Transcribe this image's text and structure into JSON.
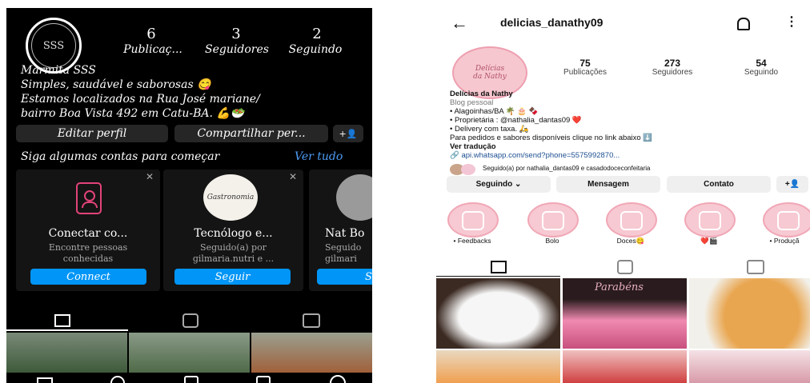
{
  "left": {
    "avatar_text": "SSS",
    "stats": [
      {
        "value": "6",
        "label": "Publicaç..."
      },
      {
        "value": "3",
        "label": "Seguidores"
      },
      {
        "value": "2",
        "label": "Seguindo"
      }
    ],
    "bio": [
      "Marmita SSS",
      "Simples, saudável e saborosas 😋",
      "Estamos localizados na Rua José mariane/",
      "bairro Boa Vista 492 em Catu-BA. 💪🥗"
    ],
    "buttons": {
      "edit": "Editar perfil",
      "share": "Compartilhar per...",
      "add": "+👤"
    },
    "suggest_heading": "Siga algumas contas para começar",
    "see_all": "Ver tudo",
    "cards": [
      {
        "title": "Conectar co...",
        "subtitle": "Encontre pessoas conhecidas",
        "button": "Connect"
      },
      {
        "title": "Tecnólogo e...",
        "subtitle": "Seguido(a) por gilmaria.nutri e ...",
        "button": "Seguir",
        "logo": "Gastronomia"
      },
      {
        "title": "Nat Bo",
        "subtitle": "Seguido gilmari",
        "button": "Seg"
      }
    ],
    "accent": "#0095f6"
  },
  "right": {
    "username": "delicias_danathy09",
    "avatar_text": "Delícias da Nathy",
    "stats": [
      {
        "value": "75",
        "label": "Publicações"
      },
      {
        "value": "273",
        "label": "Seguidores"
      },
      {
        "value": "54",
        "label": "Seguindo"
      }
    ],
    "name": "Delícias da Nathy",
    "category": "Blog pessoal",
    "bio": [
      "• Alagoinhas/BA 🌴 🎂 🍫",
      "• Proprietária : @nathalia_dantas09 ❤️",
      "• Delivery com taxa. 🛵",
      "Para pedidos e sabores disponíveis clique no link abaixo ⬇️"
    ],
    "translate": "Ver tradução",
    "link": "api.whatsapp.com/send?phone=5575992870...",
    "followed_by": "Seguido(a) por nathalia_dantas09 e casadodoceconfeitaria",
    "buttons": {
      "following": "Seguindo ⌄",
      "message": "Mensagem",
      "contact": "Contato",
      "add": "+👤"
    },
    "highlights": [
      "• Feedbacks",
      "Bolo",
      "Doces😋",
      "❤️🎬",
      "• Produçã"
    ],
    "grid_text": "Parabéns"
  }
}
